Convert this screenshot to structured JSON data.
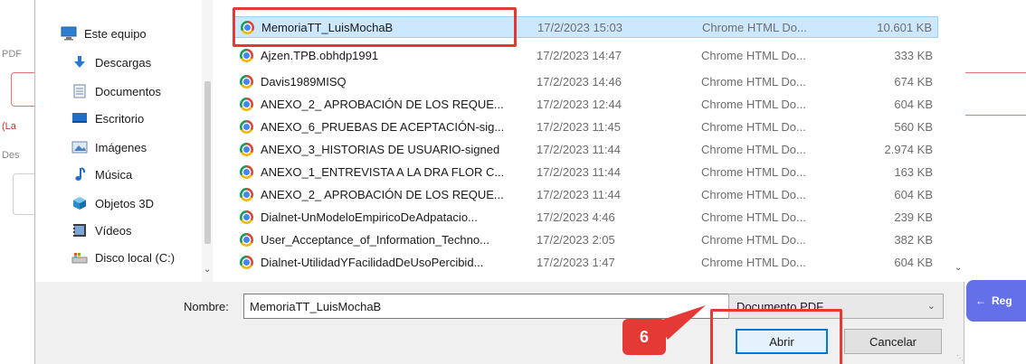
{
  "background": {
    "label_pdf": "PDF",
    "label_la": "(La",
    "label_des": "Des",
    "register_button": "Reg",
    "register_arrow": "←"
  },
  "sidebar": {
    "items": [
      {
        "label": "Este equipo",
        "icon": "computer-icon"
      },
      {
        "label": "Descargas",
        "icon": "download-icon"
      },
      {
        "label": "Documentos",
        "icon": "documents-icon"
      },
      {
        "label": "Escritorio",
        "icon": "desktop-icon"
      },
      {
        "label": "Imágenes",
        "icon": "images-icon"
      },
      {
        "label": "Música",
        "icon": "music-icon"
      },
      {
        "label": "Objetos 3D",
        "icon": "objects-3d-icon"
      },
      {
        "label": "Vídeos",
        "icon": "videos-icon"
      },
      {
        "label": "Disco local (C:)",
        "icon": "disk-icon"
      }
    ]
  },
  "files": [
    {
      "name": "MemoriaTT_LuisMochaB",
      "date": "17/2/2023 15:03",
      "type": "Chrome HTML Do...",
      "size": "10.601 KB",
      "selected": true
    },
    {
      "name": "Ajzen.TPB.obhdp1991",
      "date": "17/2/2023 14:47",
      "type": "Chrome HTML Do...",
      "size": "333 KB",
      "selected": false
    },
    {
      "name": "Davis1989MISQ",
      "date": "17/2/2023 14:46",
      "type": "Chrome HTML Do...",
      "size": "674 KB",
      "selected": false
    },
    {
      "name": "ANEXO_2_ APROBACIÓN DE LOS REQUE...",
      "date": "17/2/2023 12:44",
      "type": "Chrome HTML Do...",
      "size": "604 KB",
      "selected": false
    },
    {
      "name": "ANEXO_6_PRUEBAS DE ACEPTACIÓN-sig...",
      "date": "17/2/2023 11:45",
      "type": "Chrome HTML Do...",
      "size": "560 KB",
      "selected": false
    },
    {
      "name": "ANEXO_3_HISTORIAS DE USUARIO-signed",
      "date": "17/2/2023 11:44",
      "type": "Chrome HTML Do...",
      "size": "2.974 KB",
      "selected": false
    },
    {
      "name": "ANEXO_1_ENTREVISTA A LA DRA FLOR C...",
      "date": "17/2/2023 11:44",
      "type": "Chrome HTML Do...",
      "size": "163 KB",
      "selected": false
    },
    {
      "name": "ANEXO_2_ APROBACIÓN DE LOS REQUE...",
      "date": "17/2/2023 11:44",
      "type": "Chrome HTML Do...",
      "size": "604 KB",
      "selected": false
    },
    {
      "name": "Dialnet-UnModeloEmpiricoDeAdpatacio...",
      "date": "17/2/2023 4:46",
      "type": "Chrome HTML Do...",
      "size": "239 KB",
      "selected": false
    },
    {
      "name": "User_Acceptance_of_Information_Techno...",
      "date": "17/2/2023 2:05",
      "type": "Chrome HTML Do...",
      "size": "382 KB",
      "selected": false
    },
    {
      "name": "Dialnet-UtilidadYFacilidadDeUsoPercibid...",
      "date": "17/2/2023 1:47",
      "type": "Chrome HTML Do...",
      "size": "604 KB",
      "selected": false
    }
  ],
  "bottom": {
    "name_label": "Nombre:",
    "name_value": "MemoriaTT_LuisMochaB",
    "file_type": "Documento PDF",
    "open_button": "Abrir",
    "cancel_button": "Cancelar"
  },
  "annotation": {
    "step_number": "6",
    "highlight_color": "#e53935"
  },
  "colors": {
    "selection": "#cce8ff",
    "primary_border": "#0078d7",
    "register_button": "#6370e8"
  }
}
